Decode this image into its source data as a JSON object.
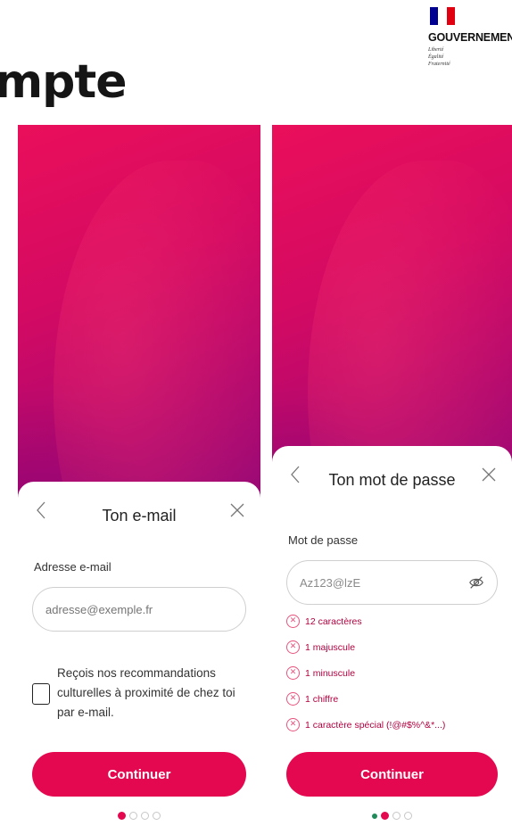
{
  "page": {
    "title": "mpte"
  },
  "gov_logo": {
    "name": "GOUVERNEMENT",
    "motto": [
      "Liberté",
      "Égalité",
      "Fraternité"
    ],
    "colors": [
      "#000091",
      "#ffffff",
      "#e1000f"
    ]
  },
  "email_screen": {
    "title": "Ton e-mail",
    "back_icon": "chevron-left-icon",
    "close_icon": "close-icon",
    "field_label": "Adresse e-mail",
    "field_placeholder": "adresse@exemple.fr",
    "checkbox_label": "Reçois nos recommandations culturelles à proximité de chez toi par e-mail.",
    "checkbox_checked": false,
    "button_label": "Continuer",
    "step_current": 1,
    "step_total": 4
  },
  "password_screen": {
    "title": "Ton mot de passe",
    "back_icon": "chevron-left-icon",
    "close_icon": "close-icon",
    "field_label": "Mot de passe",
    "field_value": "Az123@lzE",
    "eye_icon": "eye-icon",
    "rules": [
      {
        "text": "12 caractères",
        "icon": "circle-x-icon"
      },
      {
        "text": "1 majuscule",
        "icon": "circle-x-icon"
      },
      {
        "text": "1 minuscule",
        "icon": "circle-x-icon"
      },
      {
        "text": "1 chiffre",
        "icon": "circle-x-icon"
      },
      {
        "text": "1 caractère spécial (!@#$%^&*...)",
        "icon": "circle-x-icon"
      }
    ],
    "button_label": "Continuer",
    "step_current": 2,
    "step_total": 4
  },
  "colors": {
    "accent": "#e3084f",
    "hero_start": "#ea0f5a",
    "hero_end": "#8a0a7a",
    "rule_error": "#b1003f",
    "step_done": "#1f8a5a"
  }
}
